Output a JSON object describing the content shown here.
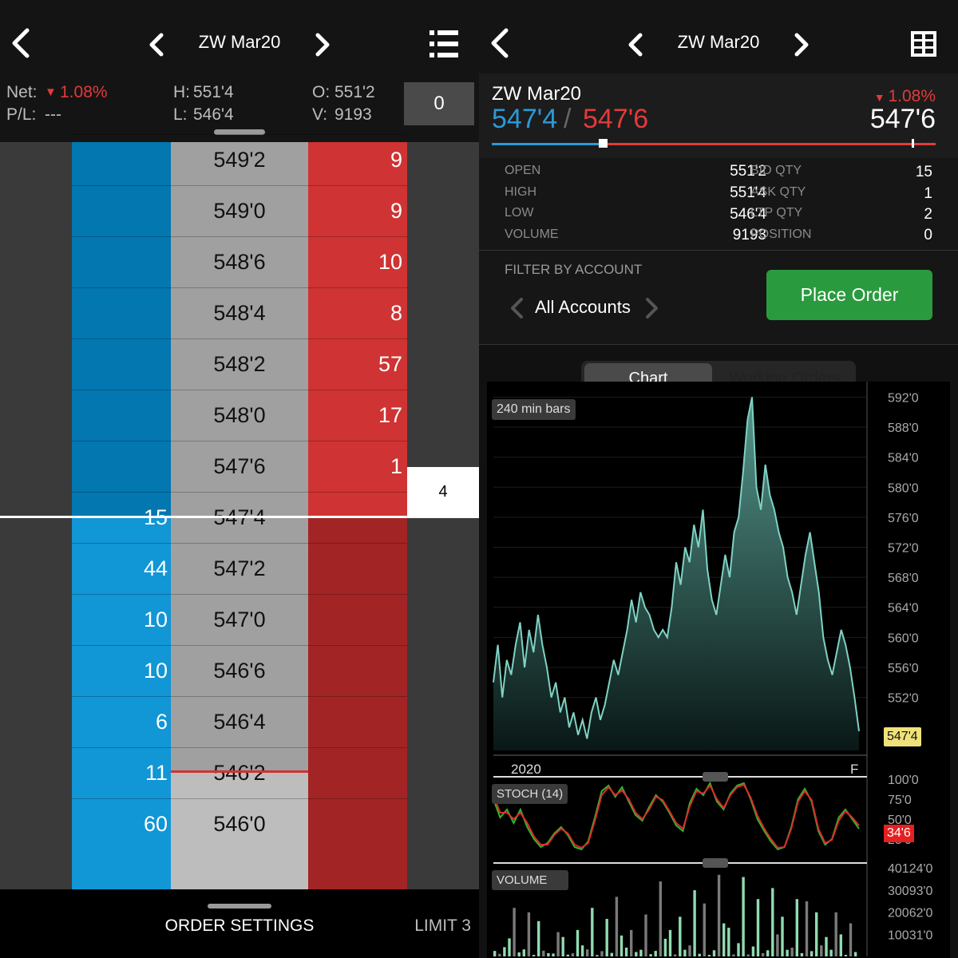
{
  "left_panel": {
    "nav": {
      "symbol": "ZW Mar20"
    },
    "stats": {
      "net_label": "Net:",
      "net_value": "1.08%",
      "pl_label": "P/L:",
      "pl_value": "---",
      "high_label": "H:",
      "high_value": "551'4",
      "low_label": "L:",
      "low_value": "546'4",
      "open_label": "O:",
      "open_value": "551'2",
      "volume_label": "V:",
      "volume_value": "9193",
      "order_qty": "0"
    },
    "ladder": [
      {
        "bid": "",
        "price": "549'2",
        "ask": "9"
      },
      {
        "bid": "",
        "price": "549'0",
        "ask": "9"
      },
      {
        "bid": "",
        "price": "548'6",
        "ask": "10"
      },
      {
        "bid": "",
        "price": "548'4",
        "ask": "8"
      },
      {
        "bid": "",
        "price": "548'2",
        "ask": "57"
      },
      {
        "bid": "",
        "price": "548'0",
        "ask": "17"
      },
      {
        "bid": "",
        "price": "547'6",
        "ask": "1"
      },
      {
        "bid": "15",
        "price": "547'4",
        "ask": ""
      },
      {
        "bid": "44",
        "price": "547'2",
        "ask": ""
      },
      {
        "bid": "10",
        "price": "547'0",
        "ask": ""
      },
      {
        "bid": "10",
        "price": "546'6",
        "ask": ""
      },
      {
        "bid": "6",
        "price": "546'4",
        "ask": ""
      },
      {
        "bid": "11",
        "price": "546'2",
        "ask": ""
      },
      {
        "bid": "60",
        "price": "546'0",
        "ask": ""
      }
    ],
    "traded_qty": "4",
    "footer": {
      "order_settings": "ORDER SETTINGS",
      "limit": "LIMIT 3"
    }
  },
  "right_panel": {
    "nav": {
      "symbol": "ZW Mar20"
    },
    "quote": {
      "symbol": "ZW Mar20",
      "bid": "547'4",
      "separator": "/",
      "ask": "547'6",
      "change_pct": "1.08%",
      "last": "547'6"
    },
    "stats": {
      "open_label": "OPEN",
      "open": "551'2",
      "high_label": "HIGH",
      "high": "551'4",
      "low_label": "LOW",
      "low": "546'4",
      "volume_label": "VOLUME",
      "volume": "9193",
      "bid_qty_label": "BID QTY",
      "bid_qty": "15",
      "ask_qty_label": "ASK QTY",
      "ask_qty": "1",
      "ltp_qty_label": "LTP QTY",
      "ltp_qty": "2",
      "position_label": "POSITION",
      "position": "0"
    },
    "filter": {
      "label": "FILTER BY ACCOUNT",
      "account": "All Accounts"
    },
    "place_order": "Place Order",
    "tabs": {
      "chart": "Chart",
      "working_orders": "Working Orders"
    },
    "chart_labels": {
      "bars": "240 min bars",
      "year": "2020",
      "month": "F",
      "last_price_tag": "547'4",
      "stoch_label": "STOCH (14)",
      "stoch_value_tag": "34'6",
      "volume_label": "VOLUME"
    }
  },
  "chart_data": [
    {
      "type": "line",
      "title": "",
      "ylabel": "",
      "xlabel": "",
      "x_labels": [
        "2020",
        "F"
      ],
      "y_ticks": [
        "592'0",
        "588'0",
        "584'0",
        "580'0",
        "576'0",
        "572'0",
        "568'0",
        "564'0",
        "560'0",
        "556'0",
        "552'0"
      ],
      "ylim": [
        546,
        593
      ],
      "last_value": "547'4",
      "series": [
        {
          "values": [
            554,
            559,
            552,
            557,
            555,
            559,
            562,
            556,
            561,
            558,
            563,
            559,
            556,
            552,
            554,
            550,
            552,
            548,
            550,
            547,
            549,
            546.5,
            550,
            552,
            549,
            551,
            554,
            557,
            555,
            558,
            561,
            565,
            562,
            566,
            564,
            563,
            561,
            560,
            561,
            560,
            564,
            570,
            567,
            572,
            570,
            575,
            572,
            577,
            569,
            565,
            563,
            567,
            571,
            568,
            574,
            576,
            582,
            589,
            592,
            580,
            577,
            583,
            579,
            577,
            574,
            572,
            568,
            566,
            563,
            567,
            571,
            574,
            570,
            566,
            560,
            557,
            555,
            558,
            561,
            559,
            556,
            552,
            547.5
          ]
        }
      ]
    },
    {
      "type": "line",
      "title": "",
      "ylabel": "",
      "xlabel": "",
      "y_ticks": [
        "100'0",
        "75'0",
        "50'0",
        "25'0"
      ],
      "ylim": [
        0,
        100
      ],
      "series": [
        {
          "values": [
            75,
            52,
            62,
            45,
            62,
            40,
            25,
            15,
            20,
            32,
            40,
            30,
            15,
            12,
            22,
            52,
            85,
            92,
            78,
            90,
            72,
            55,
            48,
            65,
            80,
            72,
            58,
            42,
            35,
            70,
            88,
            80,
            95,
            72,
            62,
            82,
            92,
            95,
            75,
            50,
            35,
            22,
            12,
            15,
            40,
            75,
            88,
            72,
            35,
            18,
            25,
            52,
            62,
            50,
            38
          ]
        },
        {
          "values": [
            80,
            58,
            58,
            50,
            58,
            45,
            28,
            18,
            18,
            30,
            38,
            32,
            18,
            14,
            20,
            48,
            80,
            90,
            80,
            86,
            75,
            58,
            50,
            62,
            78,
            74,
            60,
            45,
            38,
            66,
            85,
            82,
            92,
            75,
            64,
            80,
            90,
            93,
            77,
            54,
            38,
            25,
            14,
            15,
            38,
            72,
            85,
            74,
            38,
            20,
            24,
            48,
            60,
            52,
            42
          ]
        }
      ]
    },
    {
      "type": "bar",
      "title": "",
      "ylabel": "",
      "xlabel": "",
      "y_ticks": [
        "40124'0",
        "30093'0",
        "20062'0",
        "10031'0"
      ],
      "ylim": [
        0,
        42000
      ],
      "values": [
        2500,
        1200,
        4200,
        8200,
        22000,
        1800,
        3200,
        20000,
        700,
        16000,
        2600,
        1500,
        1300,
        11000,
        8800,
        800,
        1400,
        12000,
        5000,
        3200,
        22000,
        600,
        2400,
        17000,
        1600,
        27000,
        9500,
        4000,
        12000,
        2000,
        3000,
        19000,
        1000,
        2500,
        34000,
        8000,
        12000,
        900,
        18000,
        3000,
        5000,
        30000,
        1200,
        24000,
        700,
        2800,
        37000,
        15000,
        13000,
        900,
        6000,
        36000,
        900,
        4500,
        26000,
        1500,
        2800,
        31000,
        10000,
        18000,
        3000,
        4000,
        26000,
        1500,
        25000,
        2400,
        20000,
        5000,
        8800,
        3000,
        20000,
        10000,
        700,
        15000,
        2000
      ]
    }
  ]
}
